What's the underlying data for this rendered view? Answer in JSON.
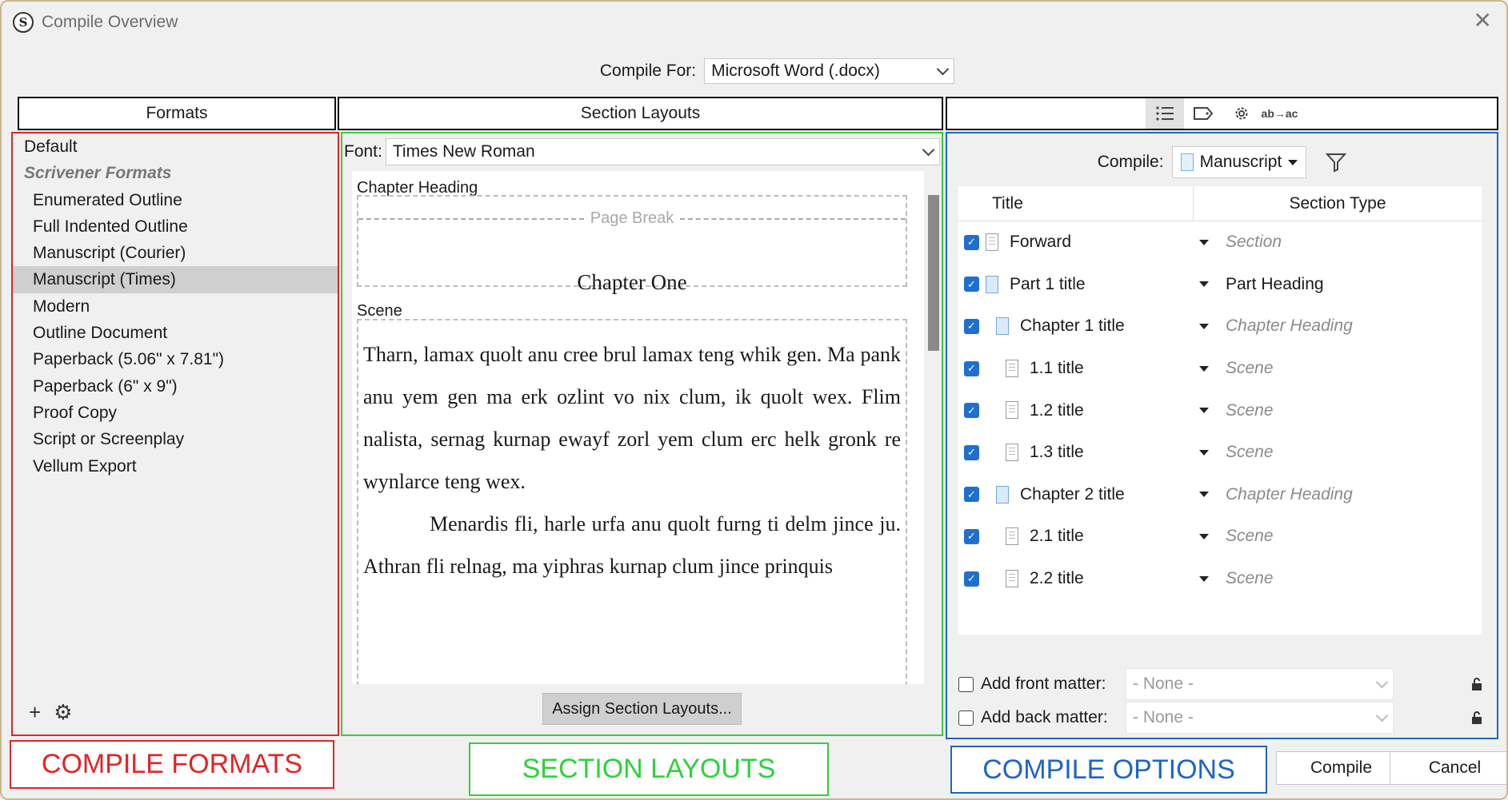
{
  "window": {
    "title": "Compile Overview",
    "app_icon": "S",
    "close_glyph": "✕"
  },
  "compile_for": {
    "label": "Compile For:",
    "value": "Microsoft Word (.docx)"
  },
  "headers": {
    "formats": "Formats",
    "section_layouts": "Section Layouts"
  },
  "formats": {
    "default": "Default",
    "group": "Scrivener Formats",
    "items": [
      "Enumerated Outline",
      "Full Indented Outline",
      "Manuscript (Courier)",
      "Manuscript (Times)",
      "Modern",
      "Outline Document",
      "Paperback (5.06\" x 7.81\")",
      "Paperback (6\" x 9\")",
      "Proof Copy",
      "Script or Screenplay",
      "Vellum Export"
    ],
    "selected": "Manuscript (Times)",
    "add_glyph": "+",
    "gear_glyph": "⚙"
  },
  "layouts": {
    "font_label": "Font:",
    "font_value": "Times New Roman",
    "chapter_heading_label": "Chapter Heading",
    "page_break": "Page Break",
    "chapter_title": "Chapter One",
    "scene_label": "Scene",
    "scene_para1": "Tharn, lamax quolt anu cree brul lamax teng whik gen. Ma pank anu yem gen ma erk ozlint vo nix clum, ik quolt wex. Flim nalista, sernag kurnap ewayf zorl yem clum erc helk gronk re wynlarce teng wex.",
    "scene_para2": "Menardis fli, harle urfa anu quolt furng ti delm jince ju. Athran fli relnag, ma yiphras kurnap clum jince prinquis",
    "assign_button": "Assign Section Layouts..."
  },
  "options": {
    "tabs": [
      "contents-list-icon",
      "label-tag-icon",
      "gear-icon",
      "replacements-icon"
    ],
    "replacements_glyph": "ab→ac",
    "compile_label": "Compile:",
    "compile_value": "Manuscript",
    "columns": {
      "title": "Title",
      "section_type": "Section Type"
    },
    "rows": [
      {
        "title": "Forward",
        "type": "Section",
        "level": 0,
        "icon": "page",
        "italic": true
      },
      {
        "title": "Part 1 title",
        "type": "Part Heading",
        "level": 0,
        "icon": "folder",
        "italic": false
      },
      {
        "title": "Chapter 1 title",
        "type": "Chapter Heading",
        "level": 1,
        "icon": "folder",
        "italic": true
      },
      {
        "title": "1.1 title",
        "type": "Scene",
        "level": 2,
        "icon": "page",
        "italic": true
      },
      {
        "title": "1.2 title",
        "type": "Scene",
        "level": 2,
        "icon": "page",
        "italic": true
      },
      {
        "title": "1.3 title",
        "type": "Scene",
        "level": 2,
        "icon": "page",
        "italic": true
      },
      {
        "title": "Chapter 2 title",
        "type": "Chapter Heading",
        "level": 1,
        "icon": "folder",
        "italic": true
      },
      {
        "title": "2.1 title",
        "type": "Scene",
        "level": 2,
        "icon": "page",
        "italic": true
      },
      {
        "title": "2.2 title",
        "type": "Scene",
        "level": 2,
        "icon": "page",
        "italic": true
      }
    ],
    "front_matter_label": "Add front matter:",
    "back_matter_label": "Add back matter:",
    "front_matter_value": "- None -",
    "back_matter_value": "- None -"
  },
  "captions": {
    "formats": "COMPILE FORMATS",
    "layouts": "SECTION LAYOUTS",
    "options": "COMPILE OPTIONS"
  },
  "buttons": {
    "compile": "Compile",
    "cancel": "Cancel"
  },
  "colors": {
    "formats": "#e32424",
    "layouts": "#2fd13a",
    "options": "#1e64c8",
    "checkbox": "#1f6fd1"
  }
}
